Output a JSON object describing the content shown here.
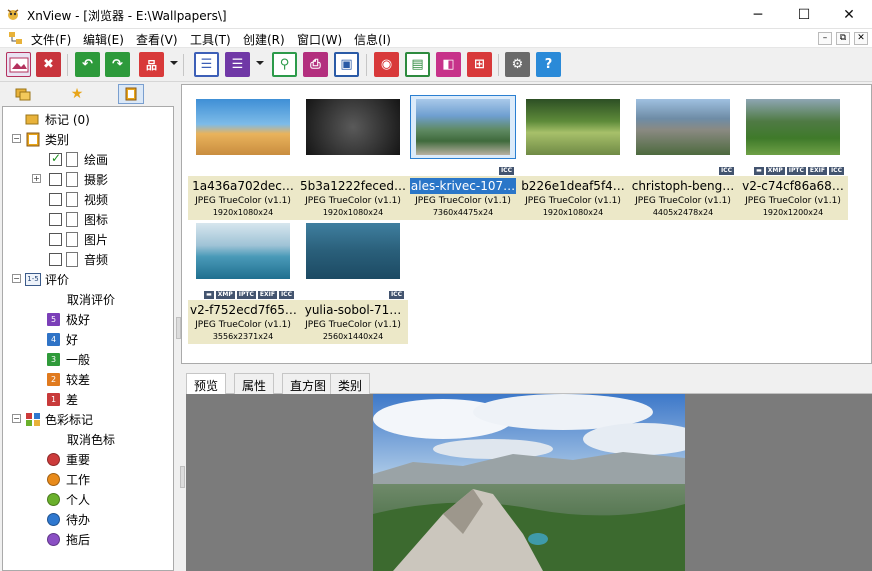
{
  "window": {
    "app_name": "XnView",
    "title": "XnView - [浏览器 - E:\\Wallpapers\\]",
    "minimize_glyph": "─",
    "maximize_glyph": "☐",
    "close_glyph": "✕"
  },
  "menu": [
    "文件(F)",
    "编辑(E)",
    "查看(V)",
    "工具(T)",
    "创建(R)",
    "窗口(W)",
    "信息(I)"
  ],
  "toolbar": [
    {
      "icon": "image-view-icon",
      "color": "#b4325e"
    },
    {
      "icon": "fullscreen-icon",
      "color": "#c8343c"
    },
    {
      "icon": "rotate-left-icon",
      "color": "#2d9a3b"
    },
    {
      "icon": "rotate-right-icon",
      "color": "#2d9a3b"
    },
    {
      "icon": "slideshow-icon",
      "color": "#d83a3a"
    },
    {
      "icon": "list-view-icon",
      "color": "#3d5fb7"
    },
    {
      "icon": "details-view-icon",
      "color": "#7038a6"
    },
    {
      "icon": "search-icon",
      "color": "#2c9a4a"
    },
    {
      "icon": "print-icon",
      "color": "#b32f7e"
    },
    {
      "icon": "capture-icon",
      "color": "#2a5aa6"
    },
    {
      "icon": "camera-icon",
      "color": "#d8393a"
    },
    {
      "icon": "convert-icon",
      "color": "#2d8a3e"
    },
    {
      "icon": "compare-icon",
      "color": "#c7328a"
    },
    {
      "icon": "contact-sheet-icon",
      "color": "#d8393a"
    },
    {
      "icon": "settings-gear-icon",
      "color": "#6a6a6a"
    },
    {
      "icon": "help-icon",
      "color": "#2a8ad8"
    }
  ],
  "tree": {
    "labels": {
      "label": "标记 (0)"
    },
    "category": {
      "label": "类别",
      "items": [
        {
          "label": "绘画",
          "checked": true
        },
        {
          "label": "摄影",
          "checked": false
        },
        {
          "label": "视频",
          "checked": false
        },
        {
          "label": "图标",
          "checked": false
        },
        {
          "label": "图片",
          "checked": false
        },
        {
          "label": "音频",
          "checked": false
        }
      ]
    },
    "rating": {
      "label": "评价",
      "icon_text": "1-5",
      "clear": "取消评价",
      "items": [
        {
          "num": "5",
          "label": "极好",
          "color": "#7b3fb8"
        },
        {
          "num": "4",
          "label": "好",
          "color": "#2f73c6"
        },
        {
          "num": "3",
          "label": "一般",
          "color": "#2f9a3a"
        },
        {
          "num": "2",
          "label": "较差",
          "color": "#e07a1e"
        },
        {
          "num": "1",
          "label": "差",
          "color": "#c83a3a"
        }
      ]
    },
    "color_labels": {
      "label": "色彩标记",
      "clear": "取消色标",
      "items": [
        {
          "label": "重要",
          "color": "#cc3b3b"
        },
        {
          "label": "工作",
          "color": "#e88a1a"
        },
        {
          "label": "个人",
          "color": "#6ab02b"
        },
        {
          "label": "待办",
          "color": "#2f78cf"
        },
        {
          "label": "拖后",
          "color": "#8a4fc4"
        }
      ]
    }
  },
  "thumbnails": [
    {
      "name": "1a436a702dec…",
      "type": "JPEG TrueColor (v1.1)",
      "size": "1920x1080x24",
      "badges": [],
      "selected": false,
      "gradient": "linear-gradient(180deg,#3f8fd6 0%,#7dbbe8 45%,#e9b35c 62%,#c98d3f 100%)"
    },
    {
      "name": "5b3a1222feced…",
      "type": "JPEG TrueColor (v1.1)",
      "size": "1920x1080x24",
      "badges": [],
      "selected": false,
      "gradient": "radial-gradient(circle at 50% 50%,#5a5a5a 0%,#2a2a2a 70%,#151515 100%)"
    },
    {
      "name": "ales-krivec-107…",
      "type": "JPEG TrueColor (v1.1)",
      "size": "7360x4475x24",
      "badges": [
        "ICC"
      ],
      "selected": true,
      "gradient": "linear-gradient(180deg,#a9c9ea 0%,#6f9fd0 30%,#5f8a63 55%,#3f6a3c 75%,#b8b0a2 100%)"
    },
    {
      "name": "b226e1deaf5f4…",
      "type": "JPEG TrueColor (v1.1)",
      "size": "1920x1080x24",
      "badges": [],
      "selected": false,
      "gradient": "linear-gradient(180deg,#2d4f24 0%,#5e8b3a 40%,#a7c06a 60%,#6f8a45 100%)"
    },
    {
      "name": "christoph-beng…",
      "type": "JPEG TrueColor (v1.1)",
      "size": "4405x2478x24",
      "badges": [
        "ICC"
      ],
      "selected": false,
      "gradient": "linear-gradient(180deg,#9fc0e0 0%,#6e8ca6 35%,#8a8a82 55%,#4d6a3e 100%)"
    },
    {
      "name": "v2-c74cf86a68…",
      "type": "JPEG TrueColor (v1.1)",
      "size": "1920x1200x24",
      "badges": [
        "▬",
        "XMP",
        "IPTC",
        "EXIF",
        "ICC"
      ],
      "selected": false,
      "gradient": "linear-gradient(180deg,#8ea6b4 0%,#4f7a44 40%,#3f7a2a 70%,#6ea046 100%)"
    },
    {
      "name": "v2-f752ecd7f65…",
      "type": "JPEG TrueColor (v1.1)",
      "size": "3556x2371x24",
      "badges": [
        "▬",
        "XMP",
        "IPTC",
        "EXIF",
        "ICC"
      ],
      "selected": false,
      "gradient": "linear-gradient(180deg,#d7e6ee 0%,#9fc3d6 40%,#4a9ab8 60%,#1f6f8f 100%)"
    },
    {
      "name": "yulia-sobol-71…",
      "type": "JPEG TrueColor (v1.1)",
      "size": "2560x1440x24",
      "badges": [
        "ICC"
      ],
      "selected": false,
      "gradient": "linear-gradient(180deg,#3f7f9f 0%,#2a5f7a 50%,#1c4a63 100%)"
    }
  ],
  "preview_tabs": [
    "预览",
    "属性",
    "直方图",
    "类别"
  ]
}
